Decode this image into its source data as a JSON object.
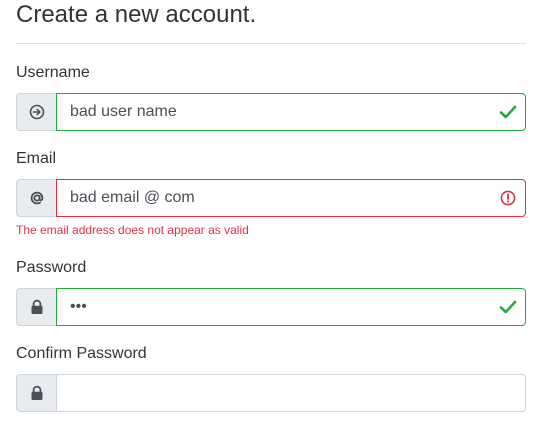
{
  "form": {
    "title": "Create a new account.",
    "username": {
      "label": "Username",
      "value": "bad user name",
      "icon": "sign-in-icon",
      "state": "valid"
    },
    "email": {
      "label": "Email",
      "value": "bad email @ com",
      "icon": "at-icon",
      "state": "invalid",
      "error": "The email address does not appear as valid"
    },
    "password": {
      "label": "Password",
      "value": "•••",
      "icon": "lock-icon",
      "state": "valid"
    },
    "confirm_password": {
      "label": "Confirm Password",
      "value": "",
      "icon": "lock-icon",
      "state": "neutral"
    }
  },
  "colors": {
    "valid": "#28a745",
    "invalid": "#dc3545",
    "addon_bg": "#e9ecef"
  }
}
